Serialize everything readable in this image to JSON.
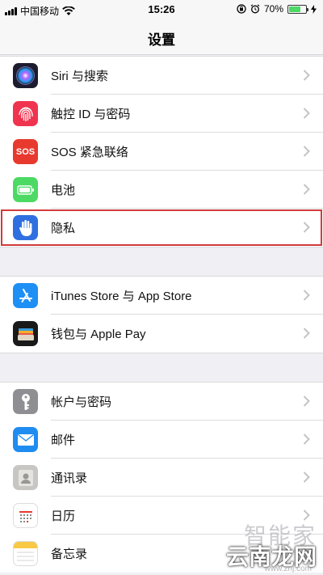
{
  "status_bar": {
    "carrier": "中国移动",
    "time": "15:26",
    "battery_percent": "70%",
    "battery_level": 0.7
  },
  "nav": {
    "title": "设置"
  },
  "groups": [
    {
      "items": [
        {
          "label": "Siri 与搜索",
          "icon": "siri-icon",
          "color": "#1c1c2e"
        },
        {
          "label": "触控 ID 与密码",
          "icon": "fingerprint-icon",
          "color": "#f0344f"
        },
        {
          "label": "SOS 紧急联络",
          "icon": "sos-icon",
          "color": "#e8392f"
        },
        {
          "label": "电池",
          "icon": "battery-icon",
          "color": "#4cd964"
        },
        {
          "label": "隐私",
          "icon": "hand-icon",
          "color": "#2f6fe0"
        }
      ]
    },
    {
      "items": [
        {
          "label": "iTunes Store 与 App Store",
          "icon": "app-store-icon",
          "color": "#1e90f5"
        },
        {
          "label": "钱包与 Apple Pay",
          "icon": "wallet-icon",
          "color": "#1a1a1a"
        }
      ]
    },
    {
      "items": [
        {
          "label": "帐户与密码",
          "icon": "key-icon",
          "color": "#8e8e93"
        },
        {
          "label": "邮件",
          "icon": "mail-icon",
          "color": "#1f8cf0"
        },
        {
          "label": "通讯录",
          "icon": "contacts-icon",
          "color": "#c8c6c2"
        },
        {
          "label": "日历",
          "icon": "calendar-icon",
          "color": "#ffffff"
        },
        {
          "label": "备忘录",
          "icon": "notes-icon",
          "color": "#ffffff"
        }
      ]
    }
  ],
  "watermark": {
    "top": "智能家",
    "bottom": "云南龙网",
    "url": "www.znj.com"
  }
}
